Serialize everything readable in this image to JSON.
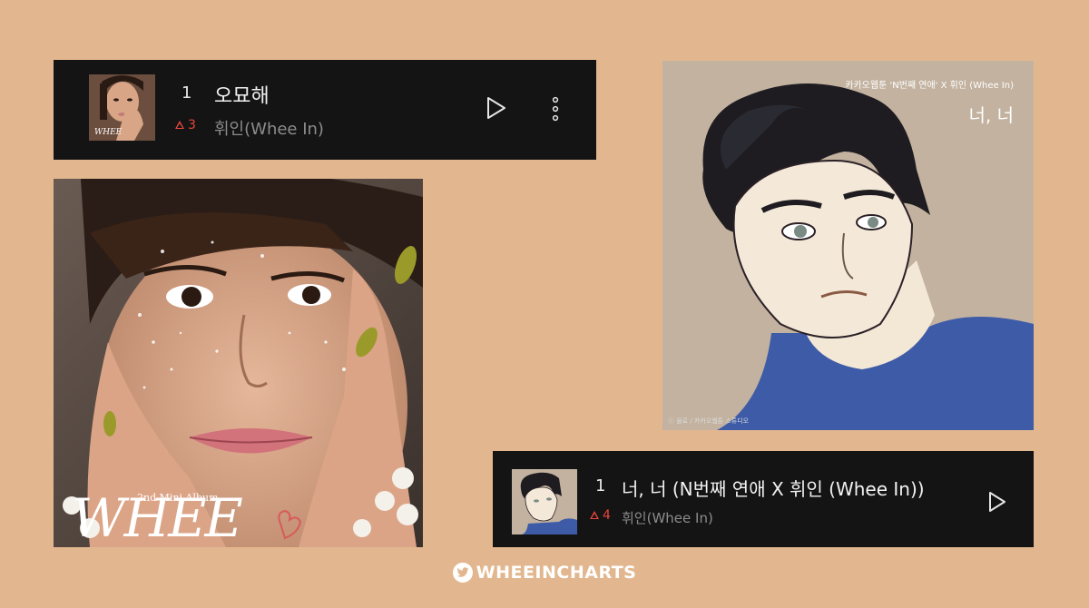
{
  "card1": {
    "rank": "1",
    "title": "오묘해",
    "artist": "휘인(Whee In)",
    "change": "3",
    "thumb_icon": "album-cover-whee"
  },
  "card2": {
    "rank": "1",
    "title": "너, 너 (N번째 연애 X 휘인 (Whee In))",
    "artist": "휘인(Whee In)",
    "change": "4",
    "thumb_icon": "album-cover-webtoon"
  },
  "art_left": {
    "subtitle": "2nd Mini Album",
    "logo": "WHEE"
  },
  "art_right": {
    "credit": "카카오웹툰 'N번째 연애' X 휘인 (Whee In)",
    "title": "너, 너",
    "bottom_credit": "ⓒ 율로 / 카카오웹툰 스튜디오"
  },
  "footer": {
    "handle": "WHEEINCHARTS",
    "icon": "twitter-bird-icon"
  },
  "colors": {
    "background": "#e2b78f",
    "card": "#141414",
    "rank_up": "#e8453c"
  }
}
